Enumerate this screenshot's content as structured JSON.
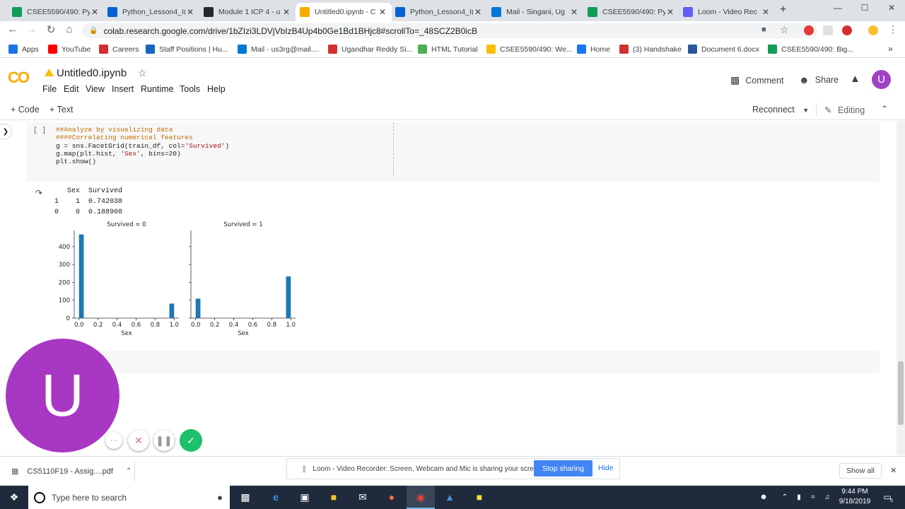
{
  "browser": {
    "tabs": [
      {
        "title": "CSEE5590/490: Py",
        "icon": "sheets-icon",
        "color": "#0f9d58"
      },
      {
        "title": "Python_Lesson4_I(",
        "icon": "box-icon",
        "color": "#0061d5"
      },
      {
        "title": "Module 1 ICP 4 - u",
        "icon": "github-icon",
        "color": "#24292e"
      },
      {
        "title": "Untitled0.ipynb - C",
        "icon": "colab-icon",
        "color": "#f9ab00"
      },
      {
        "title": "Python_Lesson4_I(",
        "icon": "box-icon",
        "color": "#0061d5"
      },
      {
        "title": "Mail - Singani, Ug",
        "icon": "outlook-icon",
        "color": "#0078d4"
      },
      {
        "title": "CSEE5590/490: Py",
        "icon": "sheets-icon",
        "color": "#0f9d58"
      },
      {
        "title": "Loom - Video Rec",
        "icon": "loom-icon",
        "color": "#625df5"
      }
    ],
    "url": "colab.research.google.com/drive/1bZIzi3LDVjVbIzB4Up4b0Ge1Bd1BHjc8#scrollTo=_48SCZ2B0icB",
    "bookmarks": [
      {
        "label": "Apps",
        "icon": "apps-icon",
        "color": "#1a73e8"
      },
      {
        "label": "YouTube",
        "icon": "youtube-icon",
        "color": "#ff0000"
      },
      {
        "label": "Careers",
        "icon": "careers-icon",
        "color": "#d32f2f"
      },
      {
        "label": "Staff Positions | Hu...",
        "icon": "staff-icon",
        "color": "#1565c0"
      },
      {
        "label": "Mail - us3rg@mail....",
        "icon": "outlook-icon",
        "color": "#0078d4"
      },
      {
        "label": "Ugandhar Reddy Si...",
        "icon": "handshake-icon",
        "color": "#d32f2f"
      },
      {
        "label": "HTML Tutorial",
        "icon": "w3-icon",
        "color": "#4caf50"
      },
      {
        "label": "CSEE5590/490: We...",
        "icon": "drive-icon",
        "color": "#fbbc04"
      },
      {
        "label": "Home",
        "icon": "facebook-icon",
        "color": "#1877f2"
      },
      {
        "label": "(3) Handshake",
        "icon": "handshake-icon",
        "color": "#d32f2f"
      },
      {
        "label": "Document 6.docx",
        "icon": "word-icon",
        "color": "#2b579a"
      },
      {
        "label": "CSEE5590/490: Big...",
        "icon": "sheets-icon",
        "color": "#0f9d58"
      }
    ],
    "more_bookmarks": "»"
  },
  "colab": {
    "logo": "CO",
    "title": "Untitled0.ipynb",
    "menu": [
      "File",
      "Edit",
      "View",
      "Insert",
      "Runtime",
      "Tools",
      "Help"
    ],
    "comment_label": "Comment",
    "share_label": "Share",
    "avatar_letter": "U",
    "add_code": "+ Code",
    "add_text": "+ Text",
    "reconnect": "Reconnect",
    "editing": "Editing"
  },
  "cell": {
    "run_indicator": "[ ]",
    "code_lines": [
      {
        "text": "##Analyze by visualizing data",
        "kind": "comment"
      },
      {
        "text": "####Correlating numerical features",
        "kind": "comment"
      },
      {
        "parts": [
          "g = sns.FacetGrid(train_df, col=",
          "'Survived'",
          ")"
        ]
      },
      {
        "parts": [
          "g.map(plt.hist, ",
          "'Sex'",
          ", bins=20)"
        ]
      },
      {
        "text": "plt.show()",
        "kind": "plain"
      }
    ]
  },
  "output": {
    "table_header": "   Sex  Survived",
    "table_rows": [
      "1    1  0.742038",
      "0    0  0.188908"
    ]
  },
  "chart_data": {
    "type": "bar",
    "panels": [
      {
        "title": "Survived = 0",
        "xlabel": "Sex",
        "bars": [
          {
            "x": 0.0,
            "value": 468
          },
          {
            "x": 1.0,
            "value": 81
          }
        ]
      },
      {
        "title": "Survived = 1",
        "xlabel": "Sex",
        "bars": [
          {
            "x": 0.0,
            "value": 109
          },
          {
            "x": 1.0,
            "value": 233
          }
        ]
      }
    ],
    "xticks": [
      "0.0",
      "0.2",
      "0.4",
      "0.6",
      "0.8",
      "1.0"
    ],
    "yticks": [
      "0",
      "100",
      "200",
      "300",
      "400"
    ],
    "xlim": [
      -0.05,
      1.05
    ],
    "ylim": [
      0,
      490
    ],
    "color": "#1f77b4"
  },
  "loom": {
    "avatar_letter": "U",
    "sharing_text": "Loom - Video Recorder: Screen, Webcam and Mic is sharing your screen.",
    "stop_label": "Stop sharing",
    "hide_label": "Hide"
  },
  "downloads": {
    "file": "CS5110F19 - Assig....pdf",
    "show_all": "Show all"
  },
  "taskbar": {
    "search_placeholder": "Type here to search",
    "time": "9:44 PM",
    "date": "9/18/2019",
    "notif_count": "5"
  }
}
